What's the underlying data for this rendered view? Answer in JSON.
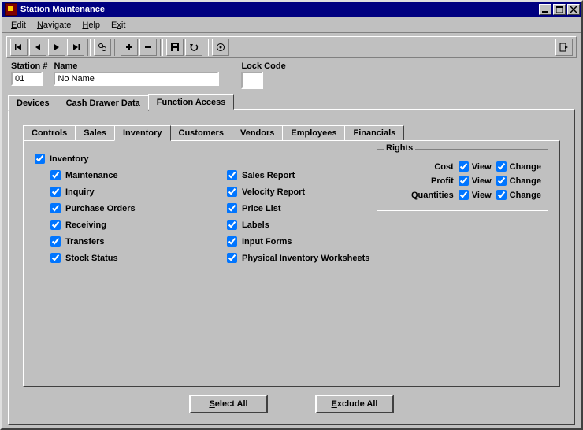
{
  "window": {
    "title": "Station Maintenance"
  },
  "menu": {
    "edit": "Edit",
    "navigate": "Navigate",
    "help": "Help",
    "exit": "Exit"
  },
  "fields": {
    "station_num_label": "Station #",
    "station_num_value": "01",
    "name_label": "Name",
    "name_value": "No Name",
    "lock_code_label": "Lock Code",
    "lock_code_value": ""
  },
  "top_tabs": {
    "devices": "Devices",
    "cash_drawer": "Cash Drawer Data",
    "function_access": "Function Access"
  },
  "inner_tabs": {
    "controls": "Controls",
    "sales": "Sales",
    "inventory": "Inventory",
    "customers": "Customers",
    "vendors": "Vendors",
    "employees": "Employees",
    "financials": "Financials"
  },
  "inventory": {
    "header": "Inventory",
    "left": {
      "maintenance": "Maintenance",
      "inquiry": "Inquiry",
      "purchase_orders": "Purchase Orders",
      "receiving": "Receiving",
      "transfers": "Transfers",
      "stock_status": "Stock Status"
    },
    "right": {
      "sales_report": "Sales Report",
      "velocity_report": "Velocity Report",
      "price_list": "Price List",
      "labels": "Labels",
      "input_forms": "Input Forms",
      "physical_worksheets": "Physical Inventory Worksheets"
    }
  },
  "rights": {
    "legend": "Rights",
    "view": "View",
    "change": "Change",
    "cost": "Cost",
    "profit": "Profit",
    "quantities": "Quantities"
  },
  "buttons": {
    "select_all": "Select All",
    "exclude_all": "Exclude All"
  }
}
